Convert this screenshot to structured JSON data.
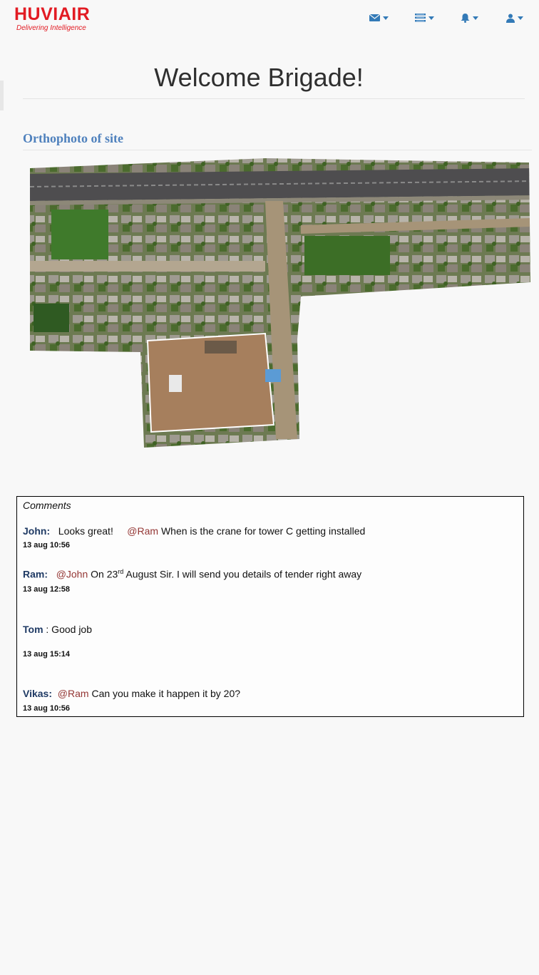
{
  "brand": {
    "name": "HUVIAIR",
    "tagline": "Delivering  Intelligence",
    "color": "#e21b23"
  },
  "nav": {
    "icons": [
      "envelope-icon",
      "list-icon",
      "bell-icon",
      "user-icon"
    ],
    "icon_color": "#337ab7"
  },
  "page": {
    "welcome": "Welcome Brigade!",
    "section_title": "Orthophoto of site"
  },
  "comments": {
    "title": "Comments",
    "items": [
      {
        "author": "John:",
        "mention": "@Ram",
        "pre": "Looks great!",
        "text": "When is the crane for tower C getting installed",
        "time": "13 aug 10:56"
      },
      {
        "author": "Ram:",
        "mention": "@John",
        "text_a": "On 23",
        "sup": "rd",
        "text_b": " August Sir. I will send you details of tender  right away",
        "time": "13 aug 12:58"
      },
      {
        "author": "Tom",
        "text": ": Good job",
        "time": "13 aug 15:14"
      },
      {
        "author": "Vikas:",
        "mention": "@Ram",
        "text": "Can you make it happen it by 20?",
        "time": "13 aug 10:56"
      }
    ]
  }
}
